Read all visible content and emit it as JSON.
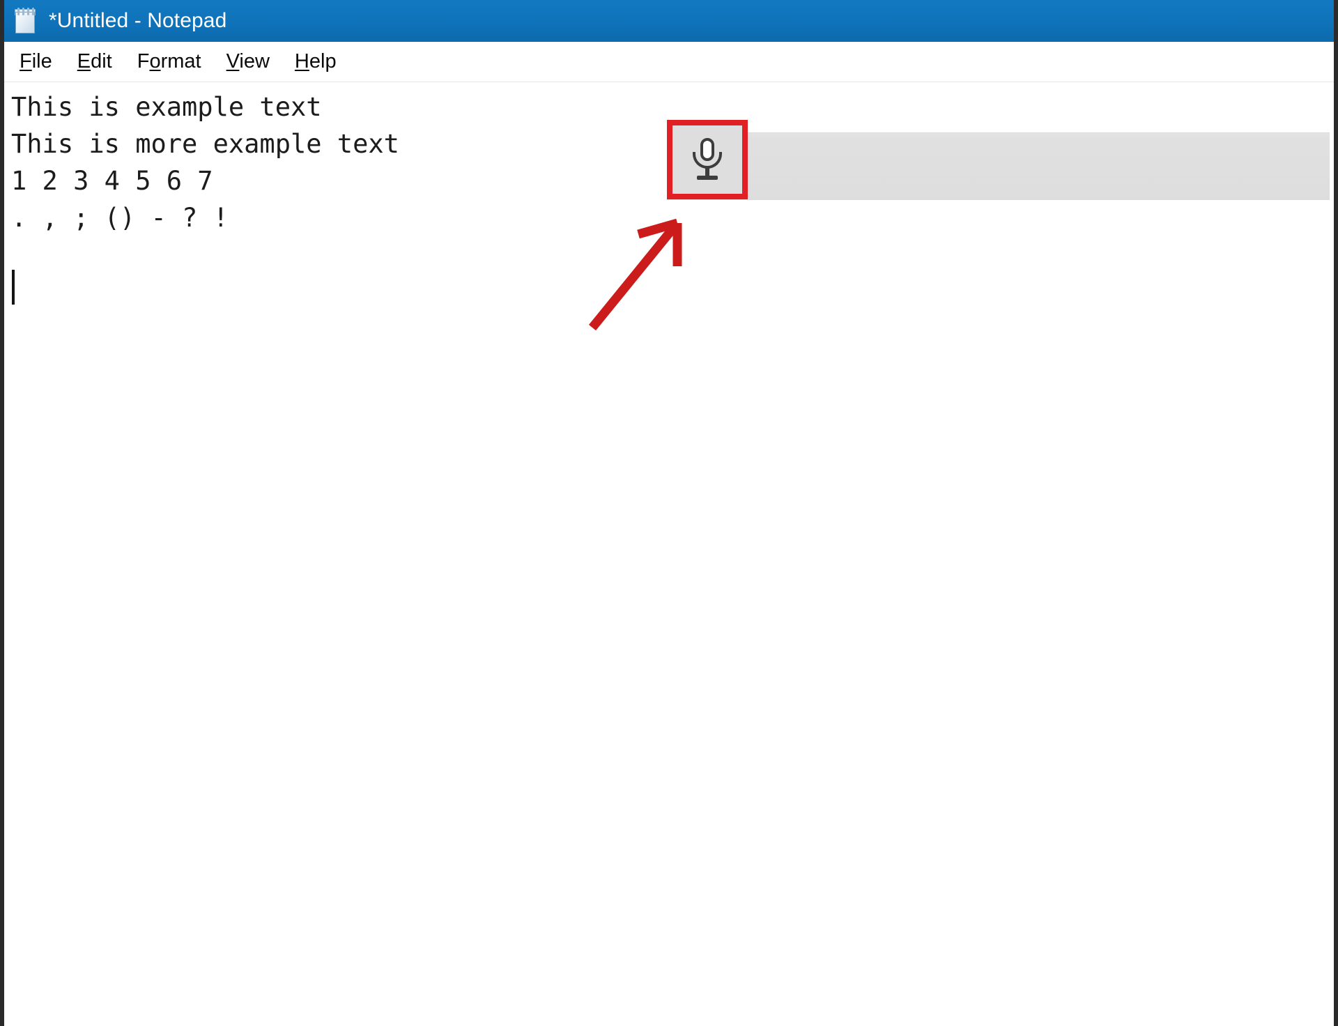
{
  "window": {
    "title": "*Untitled - Notepad",
    "app_icon": "notepad-icon",
    "titlebar_color": "#1179bf",
    "titlebar_text_color": "#ffffff"
  },
  "menubar": {
    "items": [
      {
        "label": "File",
        "accelerator": "F",
        "before": "",
        "after": "ile"
      },
      {
        "label": "Edit",
        "accelerator": "E",
        "before": "",
        "after": "dit"
      },
      {
        "label": "Format",
        "accelerator": "o",
        "before": "F",
        "after": "rmat"
      },
      {
        "label": "View",
        "accelerator": "V",
        "before": "",
        "after": "iew"
      },
      {
        "label": "Help",
        "accelerator": "H",
        "before": "",
        "after": "elp"
      }
    ]
  },
  "document": {
    "lines": [
      "This is example text",
      "This is more example text",
      "1 2 3 4 5 6 7",
      ". , ; () - ? !"
    ],
    "caret_visible": true,
    "caret_line": 6
  },
  "dictation": {
    "bar_color": "#dedede",
    "mic_button": {
      "icon": "microphone-icon",
      "state": "idle",
      "background": "#dedede"
    }
  },
  "annotations": {
    "highlight_box": {
      "color": "#e31f26",
      "target": "microphone-button",
      "border_width_px": 8
    },
    "arrow": {
      "color": "#cc1b1b",
      "points_to": "microphone-button",
      "direction": "up-right"
    }
  }
}
